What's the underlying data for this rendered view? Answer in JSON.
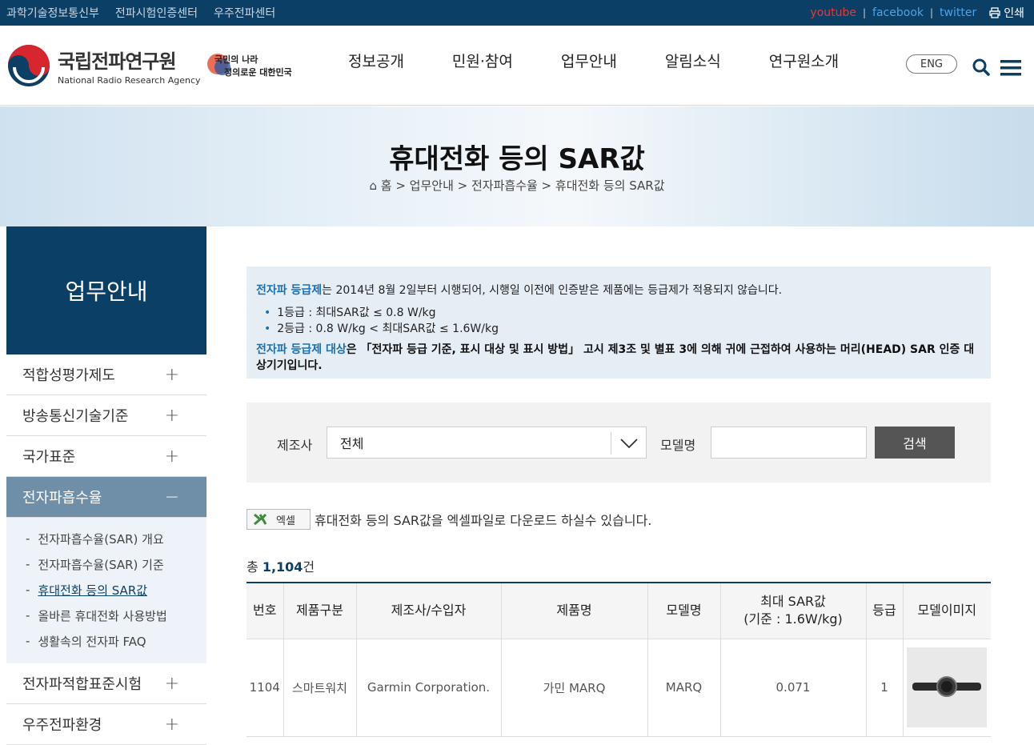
{
  "topbar": {
    "links": [
      "과학기술정보통신부",
      "전파시험인증센터",
      "우주전파센터"
    ],
    "social": {
      "youtube": "youtube",
      "facebook": "facebook",
      "twitter": "twitter"
    },
    "print": "인쇄"
  },
  "header": {
    "logo_ko": "국립전파연구원",
    "logo_en": "National Radio Research Agency",
    "slogan": "국민의 나라 정의로운 대한민국",
    "nav": [
      "정보공개",
      "민원·참여",
      "업무안내",
      "알림소식",
      "연구원소개"
    ],
    "eng": "ENG"
  },
  "banner": {
    "title": "휴대전화 등의 SAR값",
    "breadcrumb": "홈 > 업무안내 > 전자파흡수율 > 휴대전화 등의 SAR값"
  },
  "sidebar": {
    "title": "업무안내",
    "items": [
      {
        "label": "적합성평가제도",
        "toggle": "+"
      },
      {
        "label": "방송통신기술기준",
        "toggle": "+"
      },
      {
        "label": "국가표준",
        "toggle": "+"
      },
      {
        "label": "전자파흡수율",
        "toggle": "−"
      },
      {
        "label": "전자파적합표준시험",
        "toggle": "+"
      },
      {
        "label": "우주전파환경",
        "toggle": "+"
      }
    ],
    "sub": [
      "전자파흡수율(SAR) 개요",
      "전자파흡수율(SAR) 기준",
      "휴대전화 등의 SAR값",
      "올바른 휴대전화 사용방법",
      "생활속의 전자파 FAQ"
    ]
  },
  "notice": {
    "line1_hl": "전자파 등급제",
    "line1": "는 2014년 8월 2일부터 시행되어, 시행일 이전에 인증받은 제품에는 등급제가 적용되지 않습니다.",
    "grade1": "1등급 : 최대SAR값 ≤ 0.8 W/kg",
    "grade2": "2등급 : 0.8 W/kg < 최대SAR값 ≤ 1.6W/kg",
    "line2_hl": "전자파 등급제 대상",
    "line2": "은 「전자파 등급 기준, 표시 대상 및 표시 방법」 고시 제3조 및 별표 3에 의해 귀에 근접하여 사용하는 머리(HEAD) SAR 인증 대상기기입니다."
  },
  "filter": {
    "maker_label": "제조사",
    "maker_value": "전체",
    "model_label": "모델명",
    "model_value": "",
    "search": "검색"
  },
  "excel": {
    "button": "엑셀",
    "text": "휴대전화 등의 SAR값을 엑셀파일로 다운로드 하실수 있습니다."
  },
  "total": {
    "prefix": "총 ",
    "count": "1,104",
    "suffix": "건"
  },
  "table": {
    "headers": [
      "번호",
      "제품구분",
      "제조사/수입자",
      "제품명",
      "모델명",
      "최대 SAR값",
      "(기준 : 1.6W/kg)",
      "등급",
      "모델이미지"
    ],
    "rows": [
      {
        "no": "1104",
        "type": "스마트워치",
        "maker": "Garmin Corporation.",
        "product": "가민 MARQ",
        "model": "MARQ",
        "sar": "0.071",
        "grade": "1"
      }
    ]
  },
  "colors": {
    "navy": "#0c3f66",
    "accent": "#1a6fb0",
    "youtube": "#e53935"
  }
}
